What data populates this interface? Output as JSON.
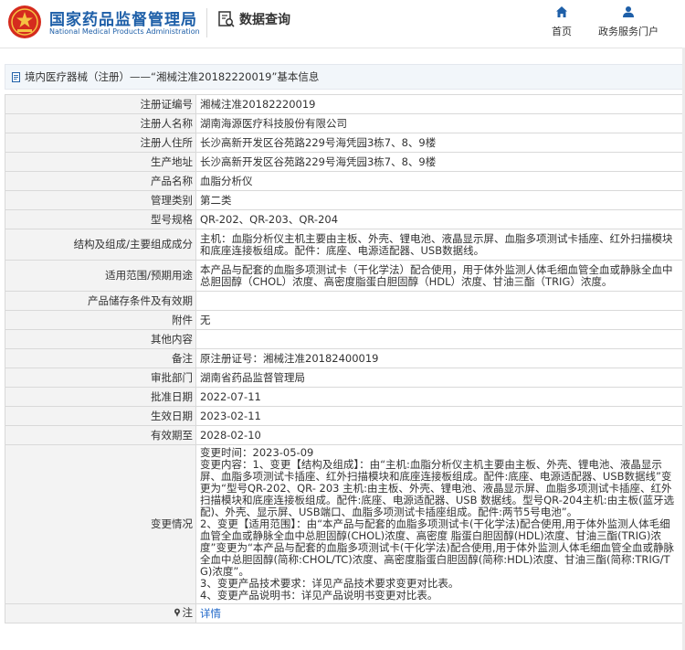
{
  "header": {
    "brand_cn": "国家药品监督管理局",
    "brand_en": "National Medical Products Administration",
    "section_title": "数据查询",
    "nav": [
      {
        "label": "首页",
        "icon": "home-icon"
      },
      {
        "label": "政务服务门户",
        "icon": "user-icon"
      }
    ]
  },
  "breadcrumb": {
    "icon": "document-icon",
    "text": "境内医疗器械（注册）——“湘械注准20182220019”基本信息"
  },
  "colors": {
    "brand_blue": "#1e5fa8",
    "link_blue": "#1e66c8",
    "logo_red": "#d52b1e"
  },
  "table": {
    "rows": [
      {
        "key": "注册证编号",
        "value": "湘械注准20182220019"
      },
      {
        "key": "注册人名称",
        "value": "湖南海源医疗科技股份有限公司"
      },
      {
        "key": "注册人住所",
        "value": "长沙高新开发区谷苑路229号海凭园3栋7、8、9楼"
      },
      {
        "key": "生产地址",
        "value": "长沙高新开发区谷苑路229号海凭园3栋7、8、9楼"
      },
      {
        "key": "产品名称",
        "value": "血脂分析仪"
      },
      {
        "key": "管理类别",
        "value": "第二类"
      },
      {
        "key": "型号规格",
        "value": "QR-202、QR-203、QR-204"
      },
      {
        "key": "结构及组成/主要组成成分",
        "value": "主机：血脂分析仪主机主要由主板、外壳、锂电池、液晶显示屏、血脂多项测试卡插座、红外扫描模块和底座连接板组成。配件：底座、电源适配器、USB数据线。"
      },
      {
        "key": "适用范围/预期用途",
        "value": "本产品与配套的血脂多项测试卡（干化学法）配合使用，用于体外监测人体毛细血管全血或静脉全血中总胆固醇（CHOL）浓度、高密度脂蛋白胆固醇（HDL）浓度、甘油三酯（TRIG）浓度。"
      },
      {
        "key": "产品储存条件及有效期",
        "value": ""
      },
      {
        "key": "附件",
        "value": "无"
      },
      {
        "key": "其他内容",
        "value": ""
      },
      {
        "key": "备注",
        "value": "原注册证号：湘械注准20182400019"
      },
      {
        "key": "审批部门",
        "value": "湖南省药品监督管理局"
      },
      {
        "key": "批准日期",
        "value": "2022-07-11"
      },
      {
        "key": "生效日期",
        "value": "2023-02-11"
      },
      {
        "key": "有效期至",
        "value": "2028-02-10"
      }
    ],
    "change": {
      "key": "变更情况",
      "lines": [
        "变更时间：2023-05-09",
        "变更内容：1、变更【结构及组成】：由“主机:血脂分析仪主机主要由主板、外壳、锂电池、液晶显示屏、血脂多项测试卡插座、红外扫描模块和底座连接板组成。配件:底座、电源适配器、USB数据线”变更为“型号QR-202、QR- 203 主机:由主板、外壳、锂电池、液晶显示屏、血脂多项测试卡插座、红外扫描模块和底座连接板组成。配件:底座、电源适配器、USB 数据线。型号QR-204主机:由主板(蓝牙选配)、外壳、显示屏、USB端口、血脂多项测试卡插座组成。配件:两节5号电池”。",
        "2、变更【适用范围】：由“本产品与配套的血脂多项测试卡(干化学法)配合使用,用于体外监测人体毛细血管全血或静脉全血中总胆固醇(CHOL)浓度、高密度 脂蛋白胆固醇(HDL)浓度、甘油三酯(TRIG)浓度”变更为“本产品与配套的血脂多项测试卡(干化学法)配合使用,用于体外监测人体毛细血管全血或静脉全血中总胆固醇(简称:CHOL/TC)浓度、高密度脂蛋白胆固醇(简称:HDL)浓度、甘油三酯(简称:TRIG/TG)浓度”。",
        "3、变更产品技术要求：详见产品技术要求变更对比表。",
        "4、变更产品说明书：详见产品说明书变更对比表。"
      ]
    },
    "note": {
      "key": "注",
      "value": "详情",
      "icon": "pin-icon"
    }
  }
}
